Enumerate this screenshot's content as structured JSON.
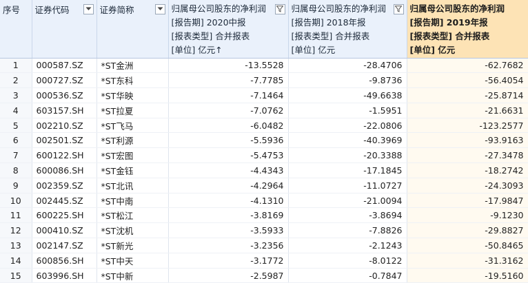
{
  "headers": {
    "seq": "序号",
    "code": "证券代码",
    "name": "证券简称",
    "col1": {
      "title": "归属母公司股东的净利润",
      "period": "[报告期] 2020中报",
      "type": "[报表类型] 合并报表",
      "unit": "[单位] 亿元↑"
    },
    "col2": {
      "title": "归属母公司股东的净利润",
      "period": "[报告期] 2018年报",
      "type": "[报表类型] 合并报表",
      "unit": "[单位] 亿元"
    },
    "col3": {
      "title": "归属母公司股东的净利润",
      "period": "[报告期] 2019年报",
      "type": "[报表类型] 合并报表",
      "unit": "[单位] 亿元"
    }
  },
  "rows": [
    {
      "seq": "1",
      "code": "000587.SZ",
      "name": "*ST金洲",
      "v2020h": "-13.5528",
      "v2018": "-28.4706",
      "v2019": "-62.7682"
    },
    {
      "seq": "2",
      "code": "000727.SZ",
      "name": "*ST东科",
      "v2020h": "-7.7785",
      "v2018": "-9.8736",
      "v2019": "-56.4054"
    },
    {
      "seq": "3",
      "code": "000536.SZ",
      "name": "*ST华映",
      "v2020h": "-7.1464",
      "v2018": "-49.6638",
      "v2019": "-25.8714"
    },
    {
      "seq": "4",
      "code": "603157.SH",
      "name": "*ST拉夏",
      "v2020h": "-7.0762",
      "v2018": "-1.5951",
      "v2019": "-21.6631"
    },
    {
      "seq": "5",
      "code": "002210.SZ",
      "name": "*ST飞马",
      "v2020h": "-6.0482",
      "v2018": "-22.0806",
      "v2019": "-123.2577"
    },
    {
      "seq": "6",
      "code": "002501.SZ",
      "name": "*ST利源",
      "v2020h": "-5.5936",
      "v2018": "-40.3969",
      "v2019": "-93.9163"
    },
    {
      "seq": "7",
      "code": "600122.SH",
      "name": "*ST宏图",
      "v2020h": "-5.4753",
      "v2018": "-20.3388",
      "v2019": "-27.3478"
    },
    {
      "seq": "8",
      "code": "600086.SH",
      "name": "*ST金钰",
      "v2020h": "-4.4343",
      "v2018": "-17.1845",
      "v2019": "-18.2742"
    },
    {
      "seq": "9",
      "code": "002359.SZ",
      "name": "*ST北讯",
      "v2020h": "-4.2964",
      "v2018": "-11.0727",
      "v2019": "-24.3093"
    },
    {
      "seq": "10",
      "code": "002445.SZ",
      "name": "*ST中南",
      "v2020h": "-4.1310",
      "v2018": "-21.0094",
      "v2019": "-17.9847"
    },
    {
      "seq": "11",
      "code": "600225.SH",
      "name": "*ST松江",
      "v2020h": "-3.8169",
      "v2018": "-3.8694",
      "v2019": "-9.1230"
    },
    {
      "seq": "12",
      "code": "000410.SZ",
      "name": "*ST沈机",
      "v2020h": "-3.5933",
      "v2018": "-7.8826",
      "v2019": "-29.8827"
    },
    {
      "seq": "13",
      "code": "002147.SZ",
      "name": "*ST新光",
      "v2020h": "-3.2356",
      "v2018": "-2.1243",
      "v2019": "-50.8465"
    },
    {
      "seq": "14",
      "code": "600856.SH",
      "name": "*ST中天",
      "v2020h": "-3.1772",
      "v2018": "-8.0122",
      "v2019": "-31.3162"
    },
    {
      "seq": "15",
      "code": "603996.SH",
      "name": "*ST中新",
      "v2020h": "-2.5987",
      "v2018": "-0.7847",
      "v2019": "-19.5160"
    }
  ]
}
